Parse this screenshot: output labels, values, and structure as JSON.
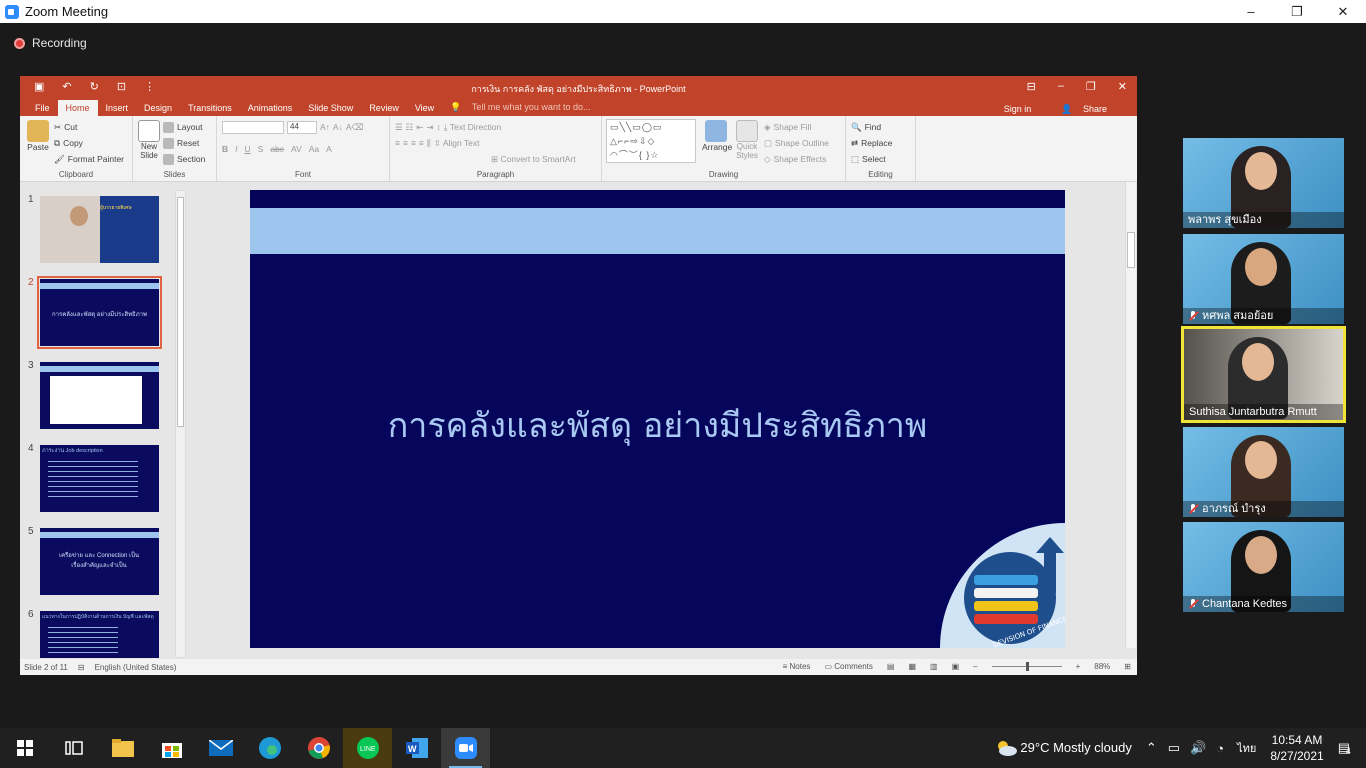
{
  "zoom": {
    "window_title": "Zoom Meeting",
    "recording_label": "Recording",
    "win_minimize": "–",
    "win_restore": "❐",
    "win_close": "✕"
  },
  "powerpoint": {
    "title": "การเงิน การคลัง พัสดุ อย่างมีประสิทธิภาพ - PowerPoint",
    "sign_in": "Sign in",
    "share": "Share",
    "tabs": [
      "File",
      "Home",
      "Insert",
      "Design",
      "Transitions",
      "Animations",
      "Slide Show",
      "Review",
      "View"
    ],
    "active_tab": "Home",
    "tell_me": "Tell me what you want to do...",
    "ribbon": {
      "clipboard": {
        "label": "Clipboard",
        "paste": "Paste",
        "cut": "Cut",
        "copy": "Copy",
        "format_painter": "Format Painter"
      },
      "slides": {
        "label": "Slides",
        "new_slide": "New Slide",
        "layout": "Layout",
        "reset": "Reset",
        "section": "Section"
      },
      "font": {
        "label": "Font",
        "size": "44"
      },
      "paragraph": {
        "label": "Paragraph",
        "text_direction": "Text Direction",
        "align_text": "Align Text",
        "convert": "Convert to SmartArt"
      },
      "drawing": {
        "label": "Drawing",
        "arrange": "Arrange",
        "quick_styles": "Quick Styles",
        "shape_fill": "Shape Fill",
        "shape_outline": "Shape Outline",
        "shape_effects": "Shape Effects"
      },
      "editing": {
        "label": "Editing",
        "find": "Find",
        "replace": "Replace",
        "select": "Select"
      }
    },
    "thumbnails": [
      {
        "num": "1",
        "caption": "ผู้บรรยายพิเศษ"
      },
      {
        "num": "2",
        "caption": "การคลังและพัสดุ อย่างมีประสิทธิภาพ"
      },
      {
        "num": "3",
        "caption": ""
      },
      {
        "num": "4",
        "caption": "ภาระงาน Job description"
      },
      {
        "num": "5",
        "caption": "เครือข่าย และ Connection เป็นเรื่องสำคัญและจำเป็น"
      },
      {
        "num": "6",
        "caption": "แนวทางในการปฏิบัติงานด้านการเงิน บัญชี และพัสดุ"
      }
    ],
    "slide_title": "การคลังและพัสดุ อย่างมีประสิทธิภาพ",
    "logo_text": "DEVISION OF FINANCE",
    "status": {
      "slide_of": "Slide 2 of 11",
      "language": "English (United States)",
      "notes": "Notes",
      "comments": "Comments",
      "zoom": "88%"
    }
  },
  "participants": [
    {
      "name": "พลาพร สุขเมือง",
      "muted": false,
      "active": false
    },
    {
      "name": "หศพล สมอย้อย",
      "muted": true,
      "active": false
    },
    {
      "name": "Suthisa  Juntarbutra Rmutt",
      "muted": false,
      "active": true
    },
    {
      "name": "อาภรณ์  บำรุง",
      "muted": true,
      "active": false
    },
    {
      "name": "Chantana Kedtes",
      "muted": true,
      "active": false
    }
  ],
  "taskbar": {
    "weather_temp": "29°C",
    "weather_desc": "Mostly cloudy",
    "lang": "ไทย",
    "time": "10:54 AM",
    "date": "8/27/2021",
    "notifications": "4",
    "apps": [
      "windows-start",
      "task-view",
      "file-explorer",
      "store",
      "mail",
      "edge",
      "chrome",
      "line",
      "word",
      "zoom"
    ]
  },
  "colors": {
    "ppt_accent": "#c0432a",
    "slide_bg": "#06055c",
    "slide_band": "#9dc5ed",
    "active_speaker": "#f0e536"
  }
}
